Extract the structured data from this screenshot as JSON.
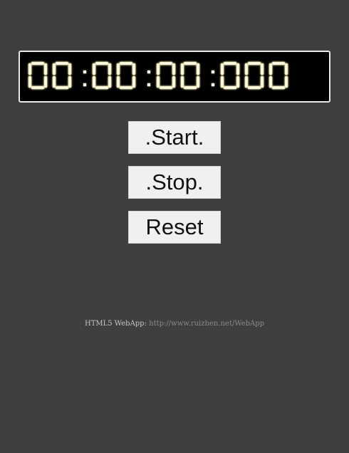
{
  "stopwatch": {
    "display": "00:00:00:000",
    "digit_color": "#fffbe6",
    "glow_color": "#d8d58a"
  },
  "buttons": {
    "start_label": ".Start.",
    "stop_label": ".Stop.",
    "reset_label": "Reset"
  },
  "footer": {
    "label": "HTML5 WebApp:",
    "link_text": "http://www.ruizhen.net/WebApp"
  }
}
